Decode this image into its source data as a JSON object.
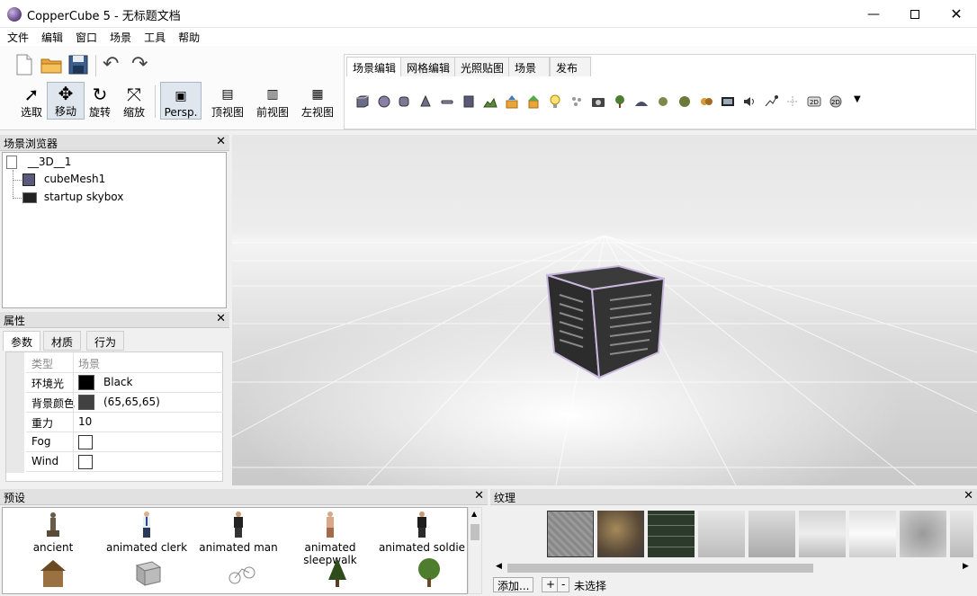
{
  "window": {
    "title": "CopperCube 5 - 无标题文档"
  },
  "menu": [
    "文件",
    "编辑",
    "窗口",
    "场景",
    "工具",
    "帮助"
  ],
  "toolbar": {
    "tools": [
      {
        "label": "选取",
        "icon": "pointer-icon"
      },
      {
        "label": "移动",
        "icon": "move-icon",
        "active": true
      },
      {
        "label": "旋转",
        "icon": "rotate-icon"
      },
      {
        "label": "缩放",
        "icon": "scale-icon"
      }
    ],
    "views": [
      {
        "label": "Persp.",
        "active": true
      },
      {
        "label": "顶视图"
      },
      {
        "label": "前视图"
      },
      {
        "label": "左视图"
      }
    ]
  },
  "editor_tabs": [
    "场景编辑",
    "网格编辑",
    "光照贴图",
    "场景",
    "发布"
  ],
  "scene_browser": {
    "title": "场景浏览器",
    "root": "__3D__1",
    "children": [
      "cubeMesh1",
      "startup skybox"
    ]
  },
  "properties": {
    "title": "属性",
    "tabs": [
      "参数",
      "材质",
      "行为"
    ],
    "rows": [
      {
        "key": "类型",
        "value": "场景"
      },
      {
        "key": "环境光",
        "value": "Black",
        "color": "#000000"
      },
      {
        "key": "背景颜色",
        "value": "(65,65,65)",
        "color": "#414141"
      },
      {
        "key": "重力",
        "value": "10"
      },
      {
        "key": "Fog",
        "value": ""
      },
      {
        "key": "Wind",
        "value": ""
      }
    ]
  },
  "presets": {
    "title": "预设",
    "items": [
      "ancient",
      "animated clerk",
      "animated man",
      "animated sleepwalk",
      "animated soldie"
    ]
  },
  "textures": {
    "title": "纹理",
    "add_label": "添加...",
    "plus": "+",
    "minus": "-",
    "status": "未选择"
  },
  "colors": {
    "accent": "#a9b7c6",
    "viewport_bg": "#e6e6e6"
  }
}
